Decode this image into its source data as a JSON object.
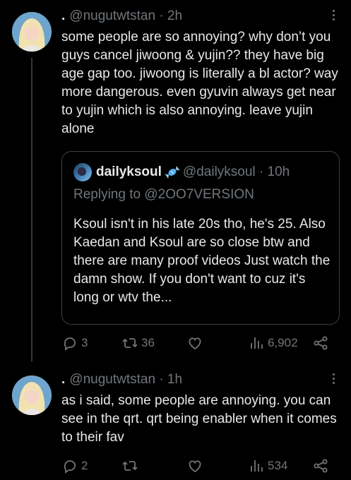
{
  "tweets": [
    {
      "handle": "@nugutwtstan",
      "time": "2h",
      "text": "some people are so annoying? why don’t you guys cancel jiwoong & yujin?? they have big age gap too. jiwoong is literally a bl actor? way more dangerous. even gyuvin always get near to yujin which is also annoying. leave yujin alone",
      "quote": {
        "name": "dailyksoul",
        "handle": "@dailyksoul",
        "time": "10h",
        "reply_label": "Replying to",
        "reply_to": "@2OO7VERSION",
        "text": "Ksoul isn't in his late 20s tho, he's 25. Also Kaedan and Ksoul are so close btw and there are many proof videos Just watch the damn show. If you don't want to cuz it's long or wtv the..."
      },
      "stats": {
        "replies": "3",
        "retweets": "36",
        "likes": "",
        "views": "6,902"
      }
    },
    {
      "handle": "@nugutwtstan",
      "time": "1h",
      "text": "as i said, some people are annoying. you can see in the qrt. qrt being enabler when it comes to their fav",
      "stats": {
        "replies": "2",
        "retweets": "",
        "likes": "",
        "views": "534"
      }
    }
  ],
  "separator": "·",
  "name_placeholder": ".",
  "icons": [
    "reply-icon",
    "retweet-icon",
    "like-icon",
    "views-icon",
    "share-icon",
    "more-icon"
  ],
  "colors": {
    "background": "#000000",
    "text": "#e7e9ea",
    "muted": "#71767b",
    "border": "#3c4043"
  }
}
